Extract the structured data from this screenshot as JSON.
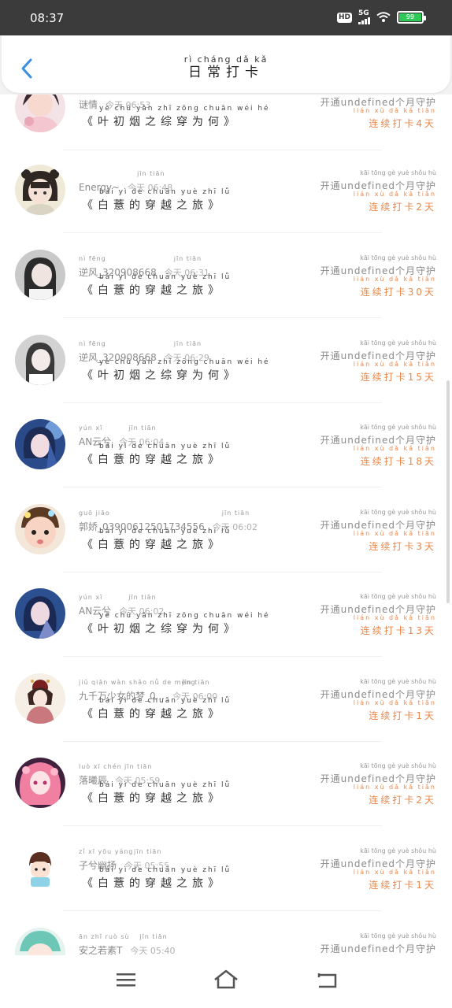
{
  "status_bar": {
    "time": "08:37",
    "hd_label": "HD",
    "network_label": "5G",
    "battery": "99",
    "icons": [
      "signal-icon",
      "wifi-icon",
      "battery-icon"
    ]
  },
  "header": {
    "title": "日常打卡",
    "title_pinyin": "rì cháng dǎ kǎ",
    "back_icon": "chevron-left-icon"
  },
  "colors": {
    "accent": "#e8874a",
    "status_bar": "#3b3b3b",
    "back_arrow": "#3a8fe0"
  },
  "list": [
    {
      "username": "谜情",
      "username_pinyin": "",
      "time": "今天 06:53",
      "time_pinyin": "",
      "book": "《叶初烟之综穿为何》",
      "book_pinyin": "yè chū yān zhī zōng chuān wéi hé",
      "status": "开通undefined个月守护",
      "status_pinyin": "",
      "streak": "连续打卡4天",
      "streak_pinyin": "lián xù dǎ kǎ tiān"
    },
    {
      "username": "Energy~",
      "username_pinyin": "",
      "time": "今天 06:48",
      "time_pinyin": "jīn tiān",
      "book": "《白薏的穿越之旅》",
      "book_pinyin": "bái yì de chuān yuè zhī lǚ",
      "status": "开通undefined个月守护",
      "status_pinyin": "kāi tōng gè yuè shǒu hù",
      "streak": "连续打卡2天",
      "streak_pinyin": "lián xù dǎ kǎ tiān"
    },
    {
      "username": "逆风_320908668",
      "username_pinyin": "nì fēng",
      "time": "今天 06:31",
      "time_pinyin": "jīn tiān",
      "book": "《白薏的穿越之旅》",
      "book_pinyin": "bái yì de chuān yuè zhī lǚ",
      "status": "开通undefined个月守护",
      "status_pinyin": "kāi tōng gè yuè shǒu hù",
      "streak": "连续打卡30天",
      "streak_pinyin": "lián xù dǎ kǎ tiān"
    },
    {
      "username": "逆风_320908668",
      "username_pinyin": "nì fēng",
      "time": "今天 06:29",
      "time_pinyin": "jīn tiān",
      "book": "《叶初烟之综穿为何》",
      "book_pinyin": "yè chū yān zhī zōng chuān wéi hé",
      "status": "开通undefined个月守护",
      "status_pinyin": "kāi tōng gè yuè shǒu hù",
      "streak": "连续打卡15天",
      "streak_pinyin": "lián xù dǎ kǎ tiān"
    },
    {
      "username": "AN云兮",
      "username_pinyin": "yún xī",
      "time": "今天 06:04",
      "time_pinyin": "jīn tiān",
      "book": "《白薏的穿越之旅》",
      "book_pinyin": "bái yì de chuān yuè zhī lǚ",
      "status": "开通undefined个月守护",
      "status_pinyin": "kāi tōng gè yuè shǒu hù",
      "streak": "连续打卡18天",
      "streak_pinyin": "lián xù dǎ kǎ tiān"
    },
    {
      "username": "郭娇_03900612501734556",
      "username_pinyin": "guō jiāo",
      "time": "今天 06:02",
      "time_pinyin": "jīn tiān",
      "book": "《白薏的穿越之旅》",
      "book_pinyin": "bái yì de chuān yuè zhī lǚ",
      "status": "开通undefined个月守护",
      "status_pinyin": "kāi tōng gè yuè shǒu hù",
      "streak": "连续打卡3天",
      "streak_pinyin": "lián xù dǎ kǎ tiān"
    },
    {
      "username": "AN云兮",
      "username_pinyin": "yún xī",
      "time": "今天 06:02",
      "time_pinyin": "jīn tiān",
      "book": "《叶初烟之综穿为何》",
      "book_pinyin": "yè chū yān zhī zōng chuān wéi hé",
      "status": "开通undefined个月守护",
      "status_pinyin": "kāi tōng gè yuè shǒu hù",
      "streak": "连续打卡13天",
      "streak_pinyin": "lián xù dǎ kǎ tiān"
    },
    {
      "username": "九千万少女的梦_0...",
      "username_pinyin": "jiǔ qiān wàn shǎo nǚ de mèng",
      "time": "今天 06:00",
      "time_pinyin": "jīn tiān",
      "book": "《白薏的穿越之旅》",
      "book_pinyin": "bái yì de chuān yuè zhī lǚ",
      "status": "开通undefined个月守护",
      "status_pinyin": "kāi tōng gè yuè shǒu hù",
      "streak": "连续打卡1天",
      "streak_pinyin": "lián xù dǎ kǎ tiān"
    },
    {
      "username": "落曦辰",
      "username_pinyin": "luò xī chén",
      "time": "今天 05:59",
      "time_pinyin": "jīn tiān",
      "book": "《白薏的穿越之旅》",
      "book_pinyin": "bái yì de chuān yuè zhī lǚ",
      "status": "开通undefined个月守护",
      "status_pinyin": "kāi tōng gè yuè shǒu hù",
      "streak": "连续打卡2天",
      "streak_pinyin": "lián xù dǎ kǎ tiān"
    },
    {
      "username": "子兮幽扬",
      "username_pinyin": "zǐ xī yōu yáng",
      "time": "今天 05:55",
      "time_pinyin": "jīn tiān",
      "book": "《白薏的穿越之旅》",
      "book_pinyin": "bái yì de chuān yuè zhī lǚ",
      "status": "开通undefined个月守护",
      "status_pinyin": "kāi tōng gè yuè shǒu hù",
      "streak": "连续打卡1天",
      "streak_pinyin": "lián xù dǎ kǎ tiān"
    },
    {
      "username": "安之若素T",
      "username_pinyin": "ān zhī ruò sù",
      "time": "今天 05:40",
      "time_pinyin": "jīn tiān",
      "book": "",
      "book_pinyin": "",
      "status": "开通undefined个月守护",
      "status_pinyin": "kāi tōng gè yuè shǒu hù",
      "streak": "",
      "streak_pinyin": ""
    }
  ],
  "bottom_nav": {
    "icons": [
      "menu-icon",
      "home-icon",
      "back-icon"
    ]
  }
}
